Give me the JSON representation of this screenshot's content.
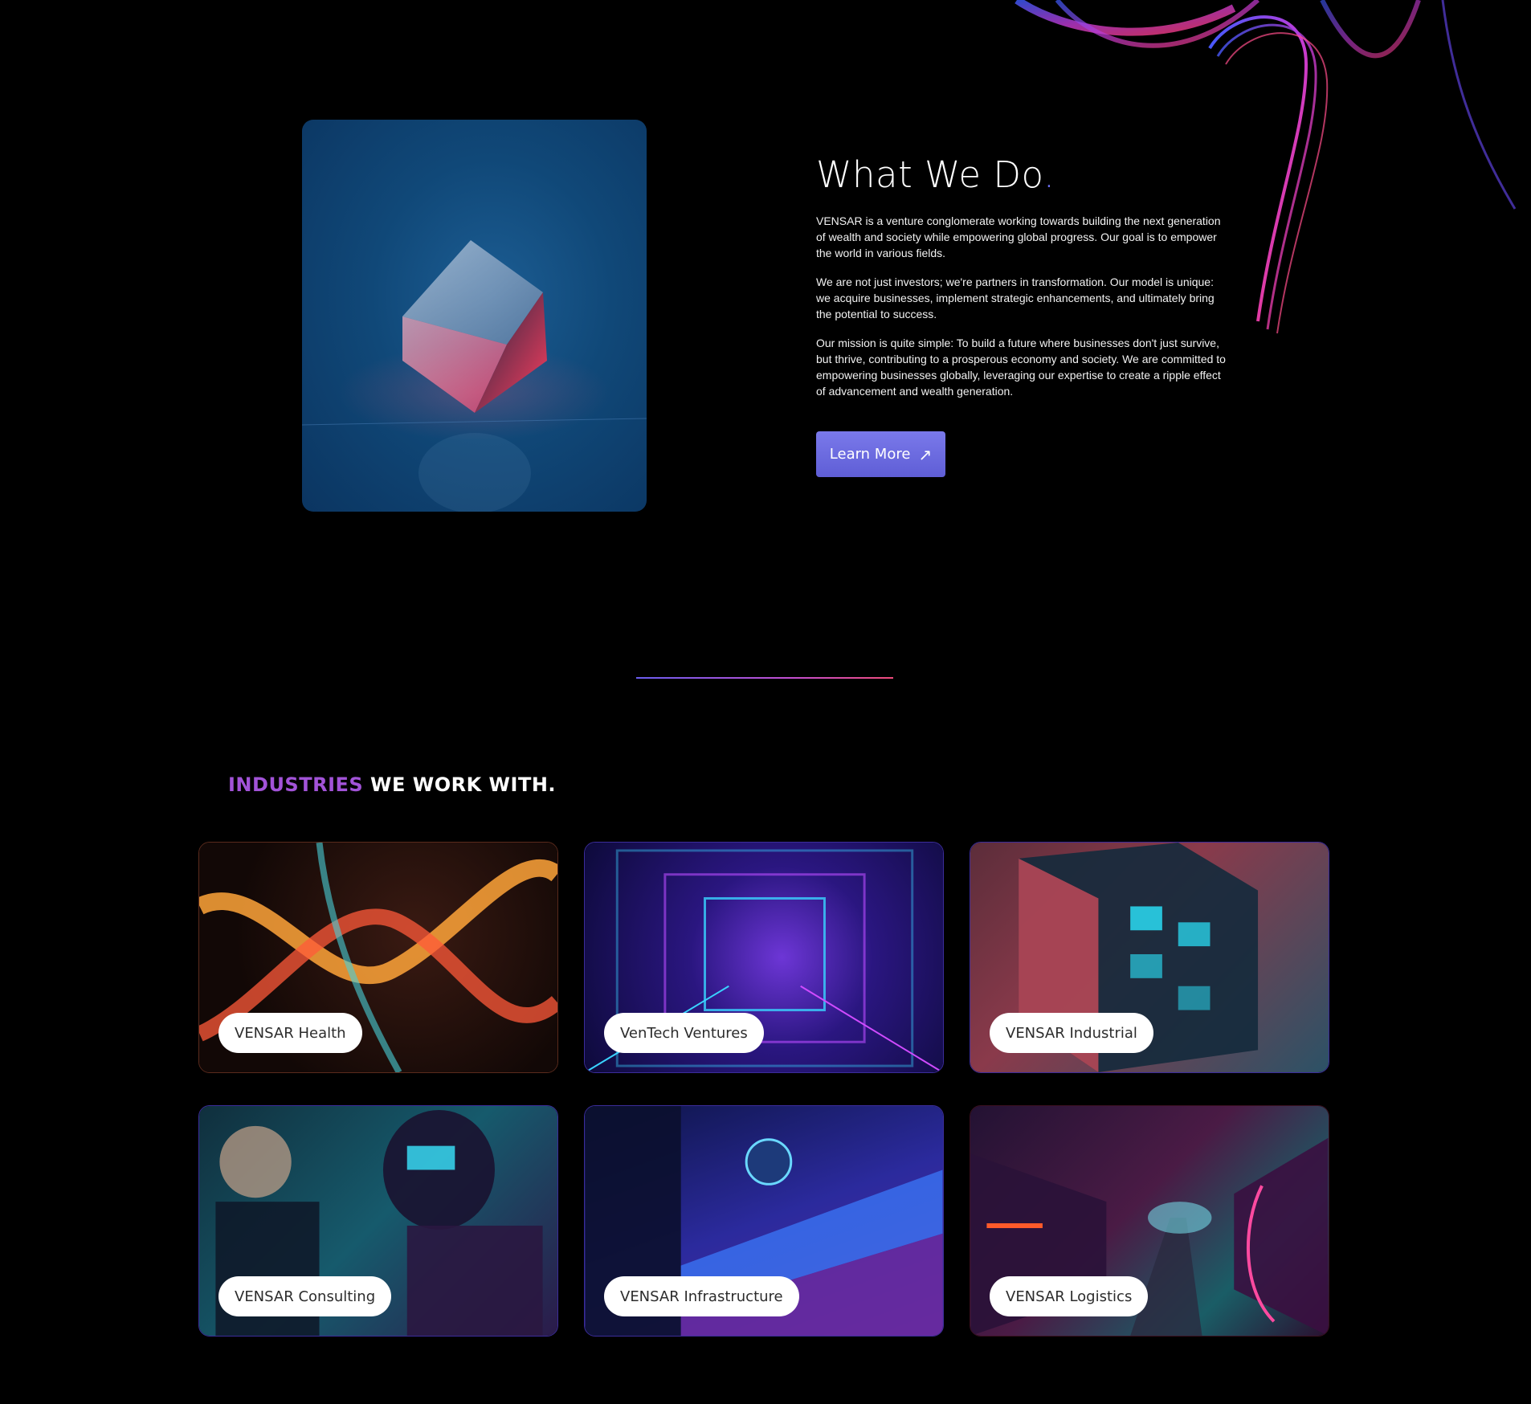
{
  "hero": {
    "title": "What We Do",
    "title_dot": ".",
    "paragraphs": [
      "VENSAR is a venture conglomerate working towards building the next generation of wealth and society while empowering global progress. Our goal is to empower the world in various fields.",
      "We are not just investors; we're partners in transformation. Our model is unique: we acquire businesses, implement strategic enhancements, and ultimately bring the potential to success.",
      "Our mission is quite simple: To build a future where businesses don't just survive, but thrive, contributing to a prosperous economy and society. We are committed to empowering businesses globally, leveraging our expertise to create a ripple effect of advancement and wealth generation."
    ],
    "button_label": "Learn More",
    "button_icon": "arrow-up-right-icon"
  },
  "industries": {
    "heading_accent": "INDUSTRIES",
    "heading_rest": " WE WORK WITH.",
    "cards": [
      {
        "label": "VENSAR Health"
      },
      {
        "label": "VenTech Ventures"
      },
      {
        "label": "VENSAR Industrial"
      },
      {
        "label": "VENSAR Consulting"
      },
      {
        "label": "VENSAR Infrastructure"
      },
      {
        "label": "VENSAR Logistics"
      }
    ]
  },
  "colors": {
    "accent_blue": "#6b6ef0",
    "button": "#6e6de2",
    "heading_accent": "#a253d8",
    "background": "#000000"
  }
}
